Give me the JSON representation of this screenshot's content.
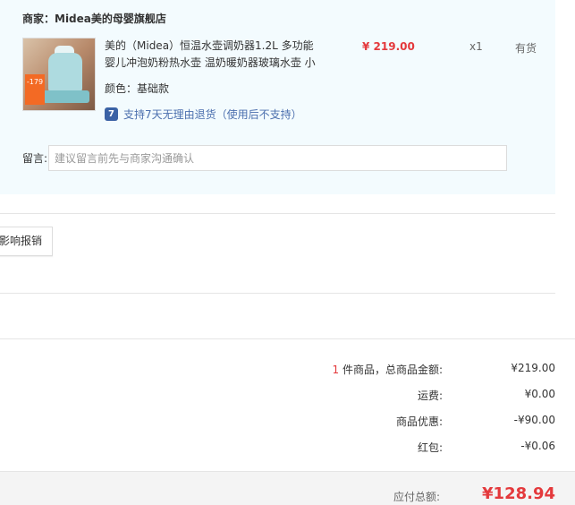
{
  "shop": {
    "name": "商家：Midea美的母婴旗舰店"
  },
  "product": {
    "image_tag": "-179",
    "title": "美的（Midea）恒温水壶调奶器1.2L 多功能婴儿冲泡奶粉热水壶 温奶暖奶器玻璃水壶 小",
    "price": "¥ 219.00",
    "quantity": "x1",
    "stock": "有货",
    "attr": "颜色：基础款",
    "return_icon": "7",
    "return_policy": "支持7天无理由退货（使用后不支持）"
  },
  "remark": {
    "label": "留言:",
    "placeholder": "建议留言前先与商家沟通确认"
  },
  "invoice": {
    "button_label": "影响报销"
  },
  "summary": {
    "count": "1",
    "count_suffix": " 件商品，总商品金额:",
    "goods_total": "¥219.00",
    "shipping_label": "运费:",
    "shipping_value": "¥0.00",
    "discount_label": "商品优惠:",
    "discount_value": "-¥90.00",
    "redpacket_label": "红包:",
    "redpacket_value": "-¥0.06"
  },
  "total": {
    "label": "应付总额:",
    "value": "¥128.94"
  },
  "colors": {
    "accent_red": "#e4393c",
    "panel_bg": "#f3fbfe",
    "link_blue": "#4b6fae"
  }
}
